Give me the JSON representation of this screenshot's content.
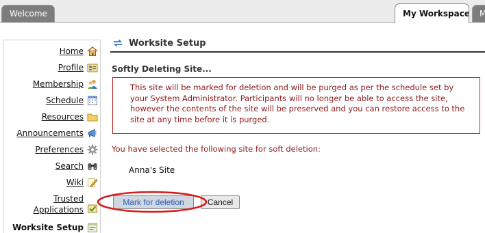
{
  "tabs": [
    {
      "label": "Welcome",
      "active": false
    },
    {
      "label": "My Workspace",
      "active": true
    },
    {
      "label": "M",
      "active": false
    }
  ],
  "tool_menu": [
    {
      "label": "Home",
      "icon": "home-icon"
    },
    {
      "label": "Profile",
      "icon": "profile-icon"
    },
    {
      "label": "Membership",
      "icon": "membership-icon"
    },
    {
      "label": "Schedule",
      "icon": "calendar-icon"
    },
    {
      "label": "Resources",
      "icon": "folder-icon"
    },
    {
      "label": "Announcements",
      "icon": "megaphone-icon"
    },
    {
      "label": "Preferences",
      "icon": "gear-icon"
    },
    {
      "label": "Search",
      "icon": "binoculars-icon"
    },
    {
      "label": "Wiki",
      "icon": "pencil-icon"
    },
    {
      "label_line1": "Trusted",
      "label_line2": "Applications",
      "icon": "trusted-apps-icon"
    },
    {
      "label": "Worksite Setup",
      "icon": "worksite-setup-icon",
      "current": true
    }
  ],
  "portlet": {
    "title": "Worksite Setup",
    "reset_icon": "reset-arrows-icon"
  },
  "page": {
    "heading": "Softly Deleting Site...",
    "alert": "This site will be marked for deletion and will be purged as per the schedule set by your System Administrator. Participants will no longer be able to access the site, however the contents of the site will be preserved and you can restore access to the site at any time before it is purged.",
    "instruction": "You have selected the following site for soft deletion:",
    "site_name": "Anna's Site"
  },
  "buttons": {
    "mark": "Mark for deletion",
    "cancel": "Cancel"
  },
  "colors": {
    "alert_text": "#8b1a1a",
    "alert_border": "#b22222",
    "highlight": "#d81b1b",
    "tab_inactive": "#7d7d7d"
  }
}
